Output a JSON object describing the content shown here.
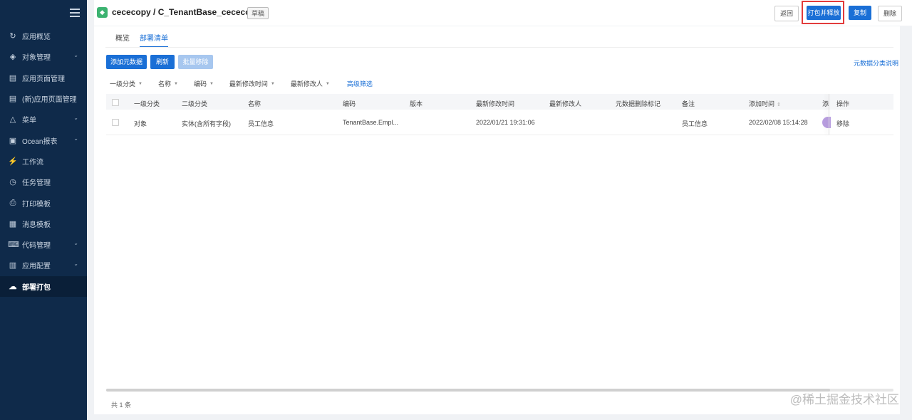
{
  "sidebar": {
    "items": [
      {
        "label": "应用概览",
        "icon": "↻",
        "icon_name": "overview-icon",
        "active": false,
        "arrow": false
      },
      {
        "label": "对象管理",
        "icon": "◈",
        "icon_name": "layers-icon",
        "active": false,
        "arrow": true
      },
      {
        "label": "应用页面管理",
        "icon": "▤",
        "icon_name": "page-icon",
        "active": false,
        "arrow": false
      },
      {
        "label": "(新)应用页面管理",
        "icon": "▤",
        "icon_name": "page-new-icon",
        "active": false,
        "arrow": false
      },
      {
        "label": "菜单",
        "icon": "△",
        "icon_name": "menu-icon",
        "active": false,
        "arrow": true
      },
      {
        "label": "Ocean报表",
        "icon": "▣",
        "icon_name": "report-icon",
        "active": false,
        "arrow": true
      },
      {
        "label": "工作流",
        "icon": "⚡",
        "icon_name": "workflow-icon",
        "active": false,
        "arrow": false
      },
      {
        "label": "任务管理",
        "icon": "◷",
        "icon_name": "clock-icon",
        "active": false,
        "arrow": false
      },
      {
        "label": "打印模板",
        "icon": "⎙",
        "icon_name": "print-icon",
        "active": false,
        "arrow": false
      },
      {
        "label": "消息模板",
        "icon": "▦",
        "icon_name": "message-icon",
        "active": false,
        "arrow": false
      },
      {
        "label": "代码管理",
        "icon": "⌨",
        "icon_name": "code-icon",
        "active": false,
        "arrow": true
      },
      {
        "label": "应用配置",
        "icon": "▥",
        "icon_name": "config-icon",
        "active": false,
        "arrow": true
      },
      {
        "label": "部署打包",
        "icon": "☁",
        "icon_name": "cloud-icon",
        "active": true,
        "arrow": false
      }
    ]
  },
  "header": {
    "logo_glyph": "◆",
    "title": "cececopy / C_TenantBase_cececopy",
    "badge": "草稿",
    "back": "返回",
    "pack": "打包并释放",
    "copy": "复制",
    "delete": "删除"
  },
  "tabs": [
    {
      "label": "概览",
      "active": false
    },
    {
      "label": "部署清单",
      "active": true
    }
  ],
  "actions": {
    "add": "添加元数据",
    "refresh": "刷新",
    "batch_remove": "批量移除",
    "meta_link": "元数据分类说明"
  },
  "filters": [
    "一级分类",
    "名称",
    "编码",
    "最新修改时间",
    "最新修改人"
  ],
  "advanced_filter": "高级筛选",
  "table": {
    "columns": [
      "一级分类",
      "二级分类",
      "名称",
      "编码",
      "版本",
      "最新修改时间",
      "最新修改人",
      "元数据删除标记",
      "备注",
      "添加时间",
      "添",
      "操作"
    ],
    "rows": [
      {
        "cat1": "对象",
        "cat2": "实体(含所有字段)",
        "name": "员工信息",
        "code": "TenantBase.Empl...",
        "version": "",
        "modified": "2022/01/21 19:31:06",
        "modifier": "",
        "delete_flag": "",
        "remark": "员工信息",
        "added": "2022/02/08 15:14:28",
        "action": "移除"
      }
    ]
  },
  "footer": {
    "total": "共 1 条"
  },
  "watermark": "@稀土掘金技术社区"
}
